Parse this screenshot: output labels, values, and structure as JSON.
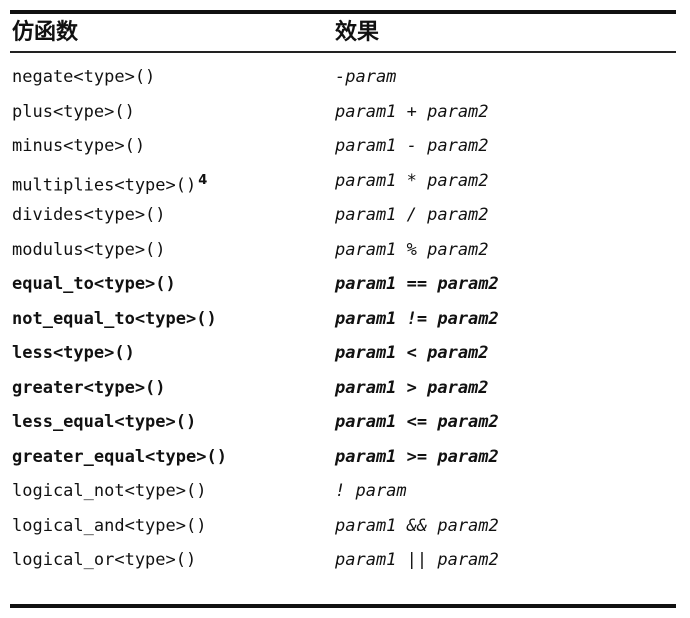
{
  "table": {
    "header": {
      "col1": "仿函数",
      "col2": "效果"
    },
    "rows": [
      {
        "functor": "negate<type>()",
        "effect": "-param",
        "bold": false,
        "note": ""
      },
      {
        "functor": "plus<type>()",
        "effect": "param1 + param2",
        "bold": false,
        "note": ""
      },
      {
        "functor": "minus<type>()",
        "effect": "param1 - param2",
        "bold": false,
        "note": ""
      },
      {
        "functor": "multiplies<type>()",
        "effect": "param1 * param2",
        "bold": false,
        "note": "4"
      },
      {
        "functor": "divides<type>()",
        "effect": "param1 / param2",
        "bold": false,
        "note": ""
      },
      {
        "functor": "modulus<type>()",
        "effect": "param1 % param2",
        "bold": false,
        "note": ""
      },
      {
        "functor": "equal_to<type>()",
        "effect": "param1 == param2",
        "bold": true,
        "note": ""
      },
      {
        "functor": "not_equal_to<type>()",
        "effect": "param1 != param2",
        "bold": true,
        "note": ""
      },
      {
        "functor": "less<type>()",
        "effect": "param1 < param2",
        "bold": true,
        "note": ""
      },
      {
        "functor": "greater<type>()",
        "effect": "param1 > param2",
        "bold": true,
        "note": ""
      },
      {
        "functor": "less_equal<type>()",
        "effect": "param1 <= param2",
        "bold": true,
        "note": ""
      },
      {
        "functor": "greater_equal<type>()",
        "effect": "param1 >= param2",
        "bold": true,
        "note": ""
      },
      {
        "functor": "logical_not<type>()",
        "effect": "! param",
        "bold": false,
        "note": ""
      },
      {
        "functor": "logical_and<type>()",
        "effect": "param1 && param2",
        "bold": false,
        "note": ""
      },
      {
        "functor": "logical_or<type>()",
        "effect": "param1 || param2",
        "bold": false,
        "note": ""
      }
    ]
  }
}
